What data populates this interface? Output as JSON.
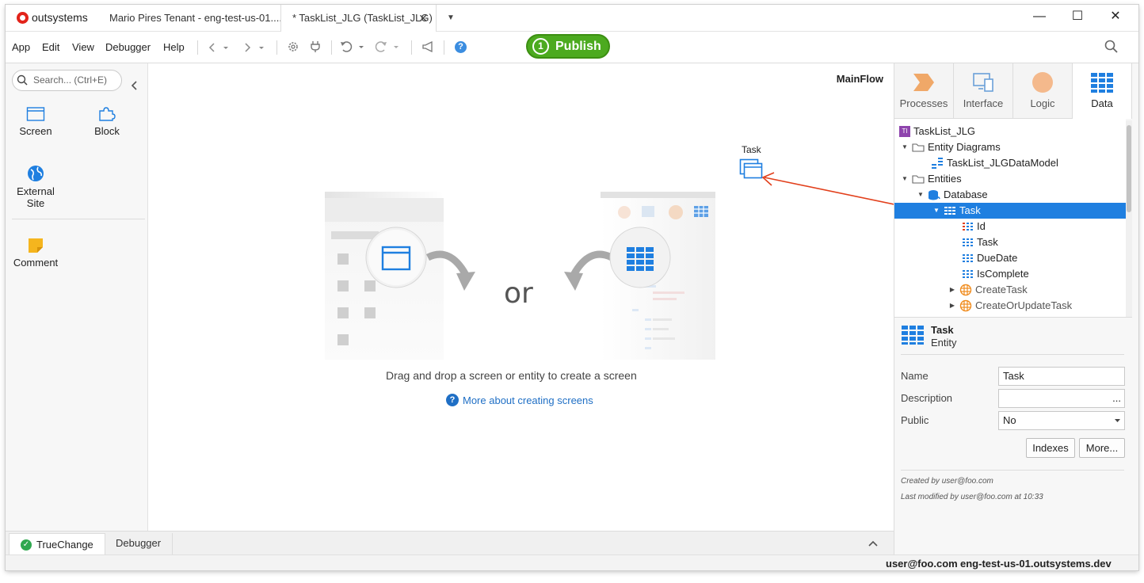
{
  "titlebar": {
    "brand": "outsystems",
    "tabs": [
      {
        "label": "Mario Pires Tenant - eng-test-us-01...."
      },
      {
        "label": "* TaskList_JLG (TaskList_JLG)"
      }
    ],
    "close_glyph": "✕",
    "dropdown_glyph": "▼",
    "window_controls": {
      "minimize": "—",
      "maximize": "☐",
      "close": "✕"
    }
  },
  "toolbar": {
    "menus": [
      "App",
      "Edit",
      "View",
      "Debugger",
      "Help"
    ],
    "publish": {
      "number": "1",
      "label": "Publish"
    },
    "help_glyph": "?"
  },
  "palette": {
    "search_placeholder": "Search... (Ctrl+E)",
    "items": [
      {
        "label": "Screen"
      },
      {
        "label": "Block"
      },
      {
        "label": "External Site"
      },
      {
        "label": "Comment"
      }
    ]
  },
  "canvas": {
    "flow_name": "MainFlow",
    "node_label": "Task",
    "or_text": "or",
    "hint": "Drag and drop a screen or entity to create a screen",
    "link": "More about creating screens",
    "link_glyph": "?"
  },
  "right_tabs": [
    {
      "label": "Processes"
    },
    {
      "label": "Interface"
    },
    {
      "label": "Logic"
    },
    {
      "label": "Data"
    }
  ],
  "tree": {
    "module_badge": "TI",
    "module": "TaskList_JLG",
    "entity_diagrams": "Entity Diagrams",
    "data_model": "TaskList_JLGDataModel",
    "entities": "Entities",
    "database": "Database",
    "task": "Task",
    "attributes": [
      "Id",
      "Task",
      "DueDate",
      "IsComplete"
    ],
    "actions": [
      "CreateTask",
      "CreateOrUpdateTask"
    ]
  },
  "properties": {
    "title": "Task",
    "subtitle": "Entity",
    "name_label": "Name",
    "name_value": "Task",
    "description_label": "Description",
    "description_value": "",
    "description_ellipsis": "...",
    "public_label": "Public",
    "public_value": "No",
    "indexes_button": "Indexes",
    "more_button": "More...",
    "created_by": "Created by user@foo.com",
    "modified_by": "Last modified by user@foo.com at 10:33"
  },
  "bottom": {
    "tabs": [
      "TrueChange",
      "Debugger"
    ],
    "check_glyph": "✓",
    "collapse_glyph": "︿"
  },
  "status": {
    "user": "user@foo.com",
    "environment": "eng-test-us-01.outsystems.dev"
  },
  "colors": {
    "brand_red": "#e2231a",
    "publish_green": "#4caa1f",
    "selection_blue": "#1f7fe0",
    "entity_blue": "#1f6fc5",
    "arrow_red": "#e2401c"
  }
}
